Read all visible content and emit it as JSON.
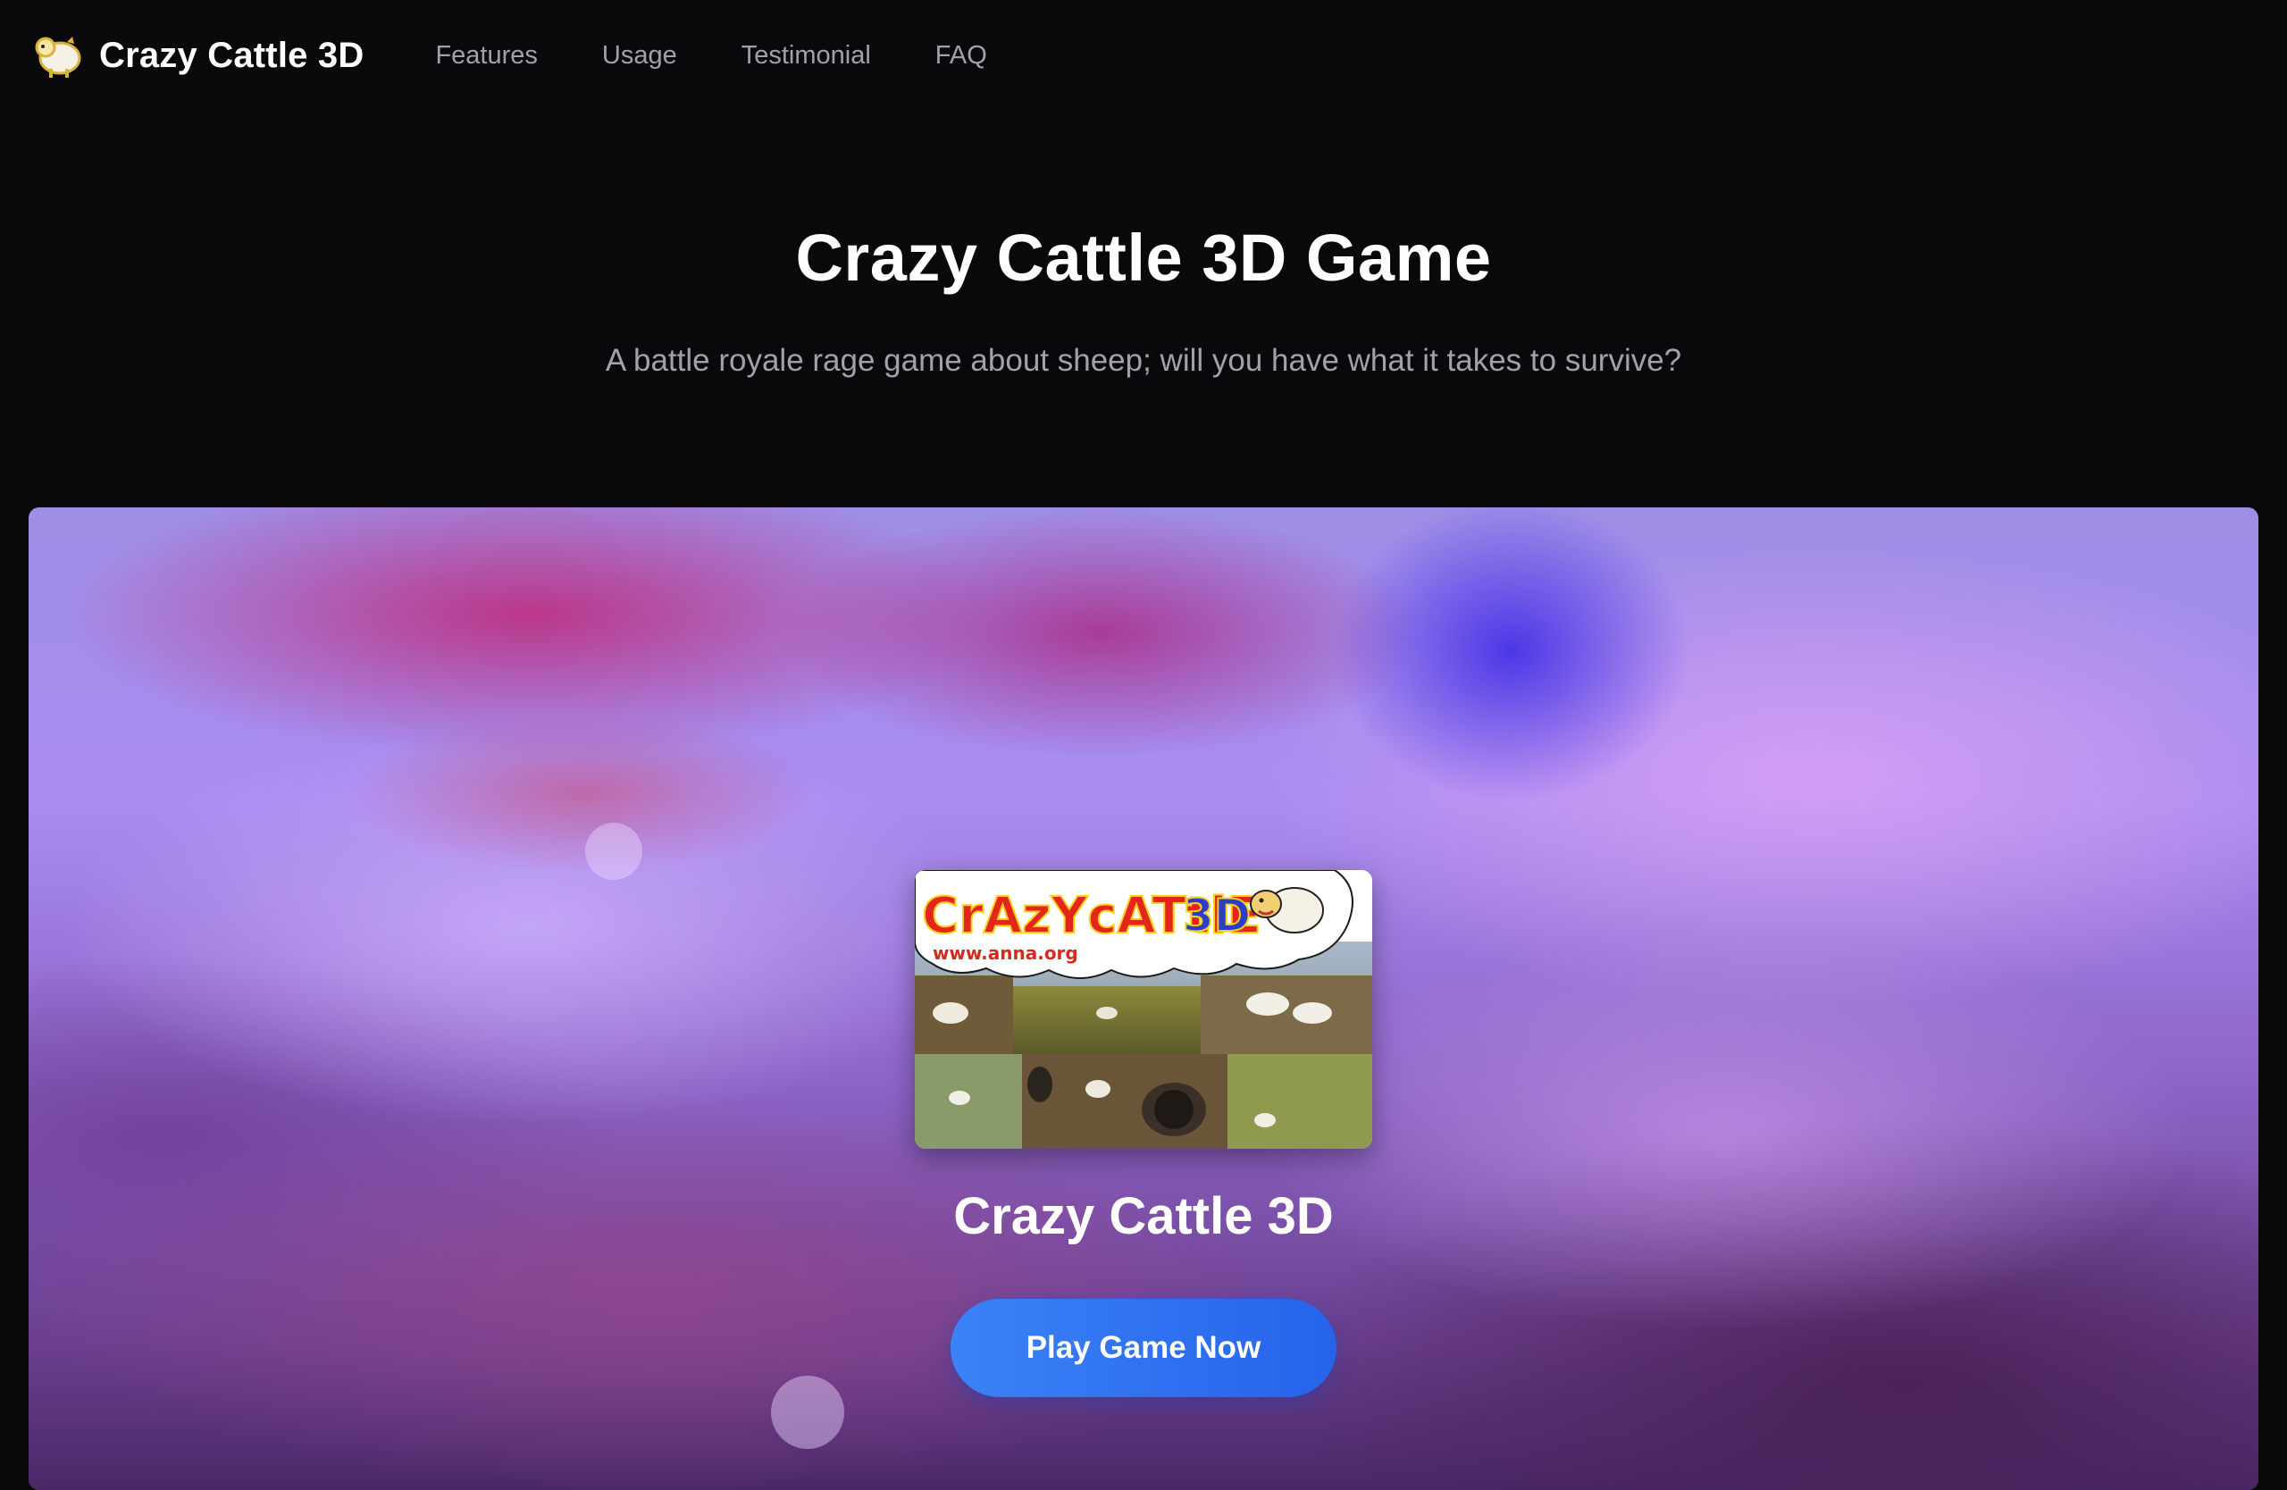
{
  "navbar": {
    "brand_name": "Crazy Cattle 3D",
    "brand_logo_icon": "sheep-logo-icon",
    "links": [
      {
        "label": "Features"
      },
      {
        "label": "Usage"
      },
      {
        "label": "Testimonial"
      },
      {
        "label": "FAQ"
      }
    ]
  },
  "hero": {
    "title": "Crazy Cattle 3D Game",
    "subtitle": "A battle royale rage game about sheep; will you have what it takes to survive?"
  },
  "game": {
    "cover_logo_text": "CrAzYcATtlE",
    "cover_logo_suffix": "3D",
    "cover_url_text": "www.anna.org",
    "name": "Crazy Cattle 3D",
    "play_button_label": "Play Game Now"
  },
  "colors": {
    "background": "#09090b",
    "muted_text": "#a1a1aa",
    "button_blue": "#3b82f6"
  }
}
